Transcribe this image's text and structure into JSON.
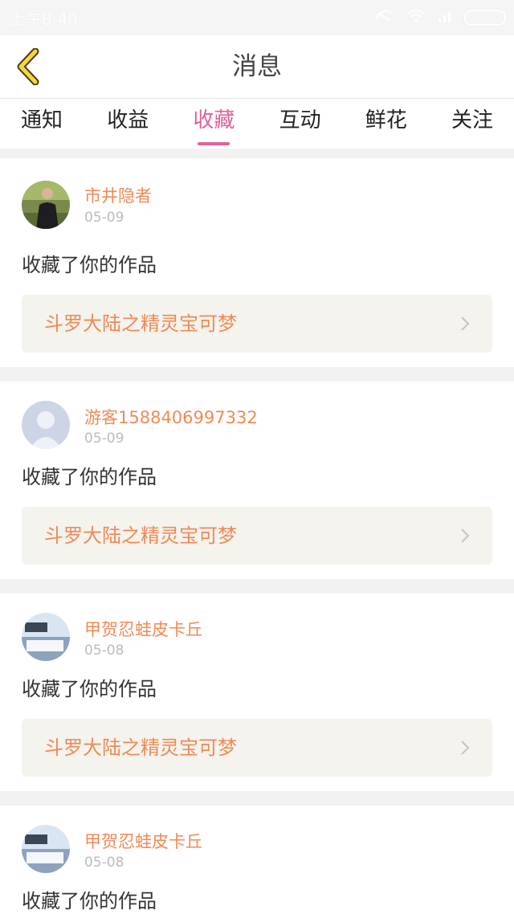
{
  "status": {
    "time": "上午8:40"
  },
  "header": {
    "title": "消息"
  },
  "tabs": [
    {
      "label": "通知"
    },
    {
      "label": "收益"
    },
    {
      "label": "收藏",
      "active": true
    },
    {
      "label": "互动"
    },
    {
      "label": "鲜花"
    },
    {
      "label": "关注"
    }
  ],
  "messages": [
    {
      "user": "市井隐者",
      "date": "05-09",
      "action": "收藏了你的作品",
      "work": "斗罗大陆之精灵宝可梦",
      "avatar": "photo"
    },
    {
      "user": "游客1588406997332",
      "date": "05-09",
      "action": "收藏了你的作品",
      "work": "斗罗大陆之精灵宝可梦",
      "avatar": "default"
    },
    {
      "user": "甲贺忍蛙皮卡丘",
      "date": "05-08",
      "action": "收藏了你的作品",
      "work": "斗罗大陆之精灵宝可梦",
      "avatar": "logo"
    },
    {
      "user": "甲贺忍蛙皮卡丘",
      "date": "05-08",
      "action": "收藏了你的作品",
      "work": "",
      "avatar": "logo"
    }
  ],
  "colors": {
    "accent": "#e0629a",
    "name": "#f08a55"
  }
}
